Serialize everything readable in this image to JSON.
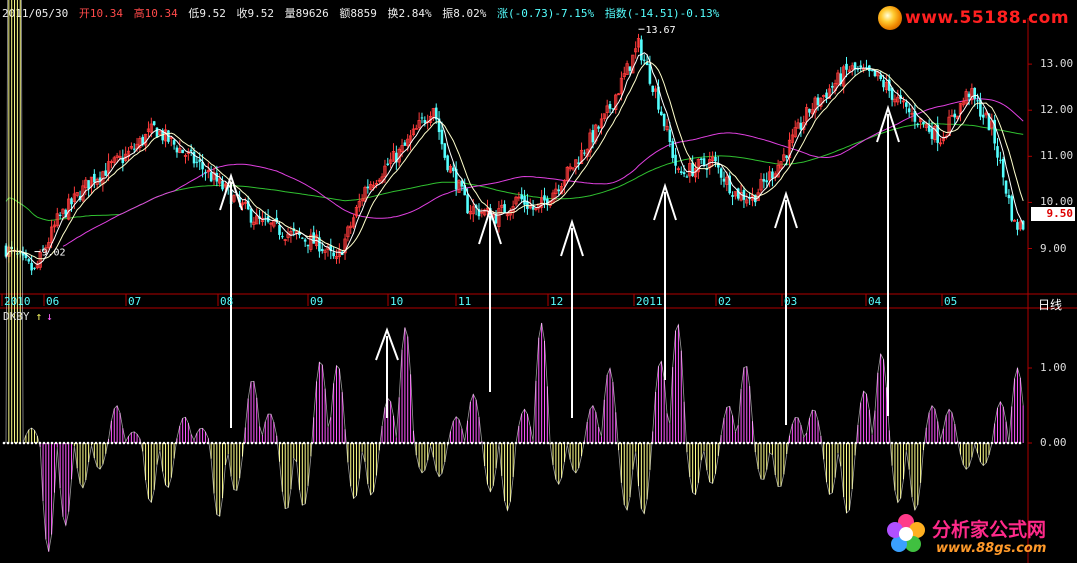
{
  "header": {
    "date": "2011/05/30",
    "open": "开10.34",
    "high": "高10.34",
    "low": "低9.52",
    "close": "收9.52",
    "volume": "量89626",
    "amount": "额8859",
    "turnover": "换2.84%",
    "amplitude": "振8.02%",
    "change": "涨(-0.73)-7.15%",
    "index": "指数(-14.51)-0.13%"
  },
  "watermark_top": "www.55188.com",
  "watermark_bottom": "分析家公式网",
  "watermark_bottom_url": "www.88gs.com",
  "indicator": {
    "name": "DKBY",
    "up_arrow": "↑",
    "down_arrow": "↓"
  },
  "timeframe": "日线",
  "current_price": "9.50",
  "colors": {
    "up_candle": "#ff3c3c",
    "down_candle": "#54ffff",
    "ma_short": "#ffffff",
    "ma_mid": "#ffffcc",
    "ma_long": "#e040e0",
    "ma_120": "#30c030",
    "bar_pos": "#ff55ff",
    "bar_neg": "#ffff88",
    "axis": "#b00000"
  },
  "chart_data": [
    {
      "type": "candlestick",
      "y_ticks": [
        "13.00",
        "12.00",
        "11.00",
        "10.00",
        "9.00"
      ],
      "ylim": [
        8.1,
        14.0
      ],
      "x_ticks": [
        "2010",
        "06",
        "07",
        "08",
        "09",
        "10",
        "11",
        "12",
        "2011",
        "02",
        "03",
        "04",
        "05"
      ],
      "annotations": [
        "13.67",
        "9.02"
      ],
      "anchors": [
        [
          0,
          9.0
        ],
        [
          10,
          8.5
        ],
        [
          18,
          9.6
        ],
        [
          30,
          10.5
        ],
        [
          42,
          11.0
        ],
        [
          52,
          11.6
        ],
        [
          60,
          11.2
        ],
        [
          68,
          10.8
        ],
        [
          78,
          10.2
        ],
        [
          88,
          9.6
        ],
        [
          100,
          9.3
        ],
        [
          110,
          9.1
        ],
        [
          116,
          8.7
        ],
        [
          126,
          10.3
        ],
        [
          140,
          11.2
        ],
        [
          150,
          12.1
        ],
        [
          154,
          11.0
        ],
        [
          162,
          9.9
        ],
        [
          172,
          9.7
        ],
        [
          180,
          10.1
        ],
        [
          186,
          9.8
        ],
        [
          198,
          10.7
        ],
        [
          210,
          11.8
        ],
        [
          222,
          13.4
        ],
        [
          228,
          12.4
        ],
        [
          236,
          10.6
        ],
        [
          248,
          10.9
        ],
        [
          256,
          10.2
        ],
        [
          262,
          10.1
        ],
        [
          272,
          10.9
        ],
        [
          282,
          12.0
        ],
        [
          296,
          12.9
        ],
        [
          306,
          12.7
        ],
        [
          316,
          12.0
        ],
        [
          328,
          11.4
        ],
        [
          338,
          12.4
        ],
        [
          346,
          11.6
        ],
        [
          354,
          9.5
        ]
      ]
    },
    {
      "type": "bar",
      "name": "DKBY",
      "y_ticks": [
        "1.00",
        "0.00"
      ],
      "ylim": [
        -1.6,
        1.6
      ],
      "lobes": [
        [
          0,
          20,
          -0.2
        ],
        [
          1,
          -1.45,
          1.1
        ],
        [
          2,
          -0.6,
          0.35
        ],
        [
          3,
          0.5,
          -0.15
        ],
        [
          4,
          -0.8,
          0.6
        ],
        [
          5,
          0.35,
          -0.2
        ],
        [
          6,
          -1.0,
          0.65
        ],
        [
          7,
          0.85,
          -0.4
        ],
        [
          8,
          -0.9,
          0.85
        ],
        [
          9,
          1.1,
          -1.05
        ],
        [
          10,
          -0.75,
          0.7
        ],
        [
          11,
          0.6,
          -1.55
        ],
        [
          12,
          -0.4,
          0.45
        ],
        [
          13,
          0.35,
          -0.65
        ],
        [
          14,
          -0.65,
          0.9
        ],
        [
          15,
          0.45,
          -1.6
        ],
        [
          16,
          -0.55,
          0.4
        ],
        [
          17,
          0.5,
          -1.0
        ],
        [
          18,
          -0.9,
          0.95
        ],
        [
          19,
          1.1,
          -1.6
        ],
        [
          20,
          -0.7,
          0.55
        ],
        [
          21,
          0.5,
          -1.05
        ],
        [
          22,
          -0.5,
          0.6
        ],
        [
          23,
          0.35,
          -0.45
        ],
        [
          24,
          -0.7,
          0.95
        ],
        [
          25,
          0.7,
          -1.2
        ],
        [
          26,
          -0.8,
          0.9
        ],
        [
          27,
          0.5,
          -0.45
        ],
        [
          28,
          -0.35,
          0.3
        ],
        [
          29,
          0.55,
          -1.0
        ]
      ]
    }
  ]
}
